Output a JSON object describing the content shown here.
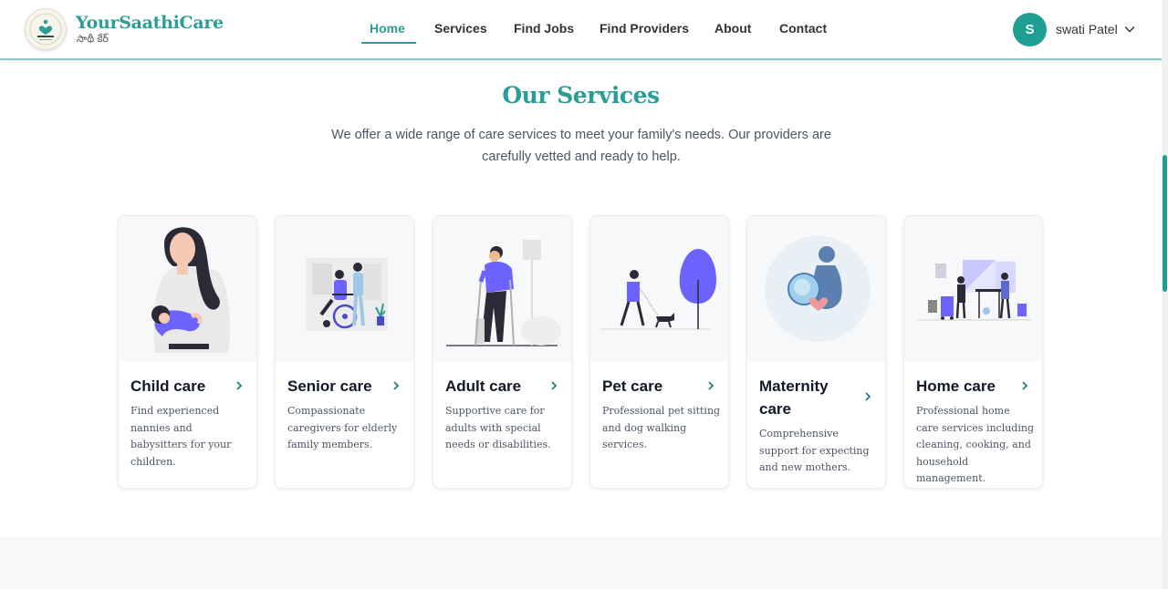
{
  "header": {
    "brand_name": "YourSaathiCare",
    "brand_sub": "సాథీ కేర్",
    "nav": [
      {
        "label": "Home",
        "active": true
      },
      {
        "label": "Services"
      },
      {
        "label": "Find Jobs"
      },
      {
        "label": "Find Providers"
      },
      {
        "label": "About"
      },
      {
        "label": "Contact"
      }
    ],
    "user": {
      "initial": "S",
      "name": "swati Patel"
    }
  },
  "services": {
    "title": "Our Services",
    "description": "We offer a wide range of care services to meet your family's needs. Our providers are carefully vetted and ready to help.",
    "cards": [
      {
        "title": "Child care",
        "desc": "Find experienced nannies and babysitters for your children."
      },
      {
        "title": "Senior care",
        "desc": "Compassionate caregivers for elderly family members."
      },
      {
        "title": "Adult care",
        "desc": "Supportive care for adults with special needs or disabilities."
      },
      {
        "title": "Pet care",
        "desc": "Professional pet sitting and dog walking services."
      },
      {
        "title": "Maternity care",
        "desc": "Comprehensive support for expecting and new mothers."
      },
      {
        "title": "Home care",
        "desc": "Professional home care services including cleaning, cooking, and household management."
      }
    ]
  },
  "colors": {
    "accent": "#2a9d96",
    "illustration": "#6c63ff",
    "avatar": "#1f9e92"
  }
}
